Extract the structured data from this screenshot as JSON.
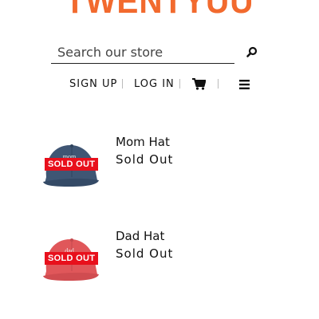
{
  "header": {
    "logo_text": "TWENTYUU",
    "brand_color": "#f26a2e"
  },
  "search": {
    "placeholder": "Search our store",
    "icon": "search-icon"
  },
  "nav": {
    "sign_up": "SIGN UP",
    "log_in": "LOG IN",
    "cart_icon": "cart-icon",
    "menu_icon": "hamburger-menu-icon"
  },
  "products": [
    {
      "name": "Mom Hat",
      "status": "Sold Out",
      "badge": "SOLD OUT",
      "hat_print": "mom",
      "hat_color": "#3f5674"
    },
    {
      "name": "Dad Hat",
      "status": "Sold Out",
      "badge": "SOLD OUT",
      "hat_print": "dad",
      "hat_color": "#e0575a"
    }
  ],
  "colors": {
    "badge_bg": "#e8101c",
    "text": "#111111"
  }
}
